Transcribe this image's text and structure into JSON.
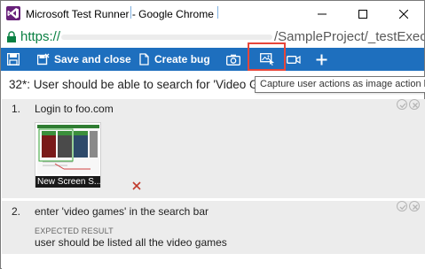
{
  "window": {
    "title": "Microsoft Test Runner - Google Chrome"
  },
  "address_bar": {
    "scheme": "https://",
    "path": "/SampleProject/_testExecu"
  },
  "toolbar": {
    "save_close_label": "Save and close",
    "create_bug_label": "Create bug",
    "accent_color": "#1e6fbe",
    "highlight_color": "#e8463a"
  },
  "tooltip": {
    "text": "Capture user actions as image action lo"
  },
  "test_case": {
    "title": "32*: User should be able to search for 'Video G"
  },
  "steps": [
    {
      "number": "1.",
      "action": "Login to foo.com",
      "attachment": {
        "label": "New Screen S..."
      }
    },
    {
      "number": "2.",
      "action": "enter 'video games' in the search bar",
      "expected_label": "EXPECTED RESULT",
      "expected_result": "user should be listed all the video games"
    }
  ]
}
